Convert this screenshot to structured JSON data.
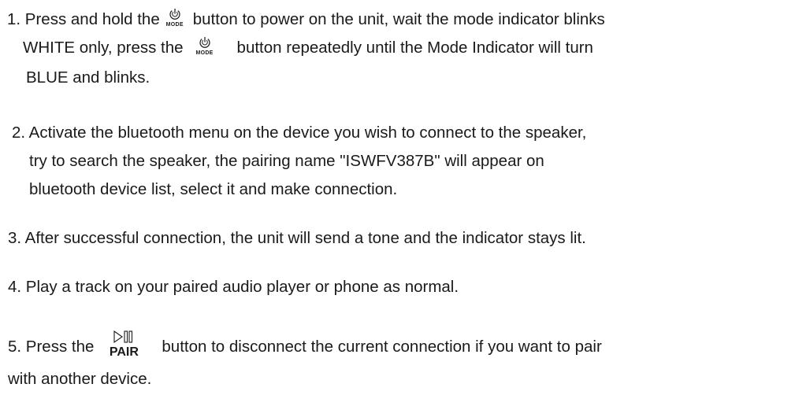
{
  "steps": [
    {
      "lines": [
        {
          "before": "1. Press and hold the",
          "after": "button to power on the unit, wait the mode indicator blinks"
        },
        {
          "before": "WHITE only,  press the",
          "after": "button repeatedly until the Mode Indicator will turn"
        },
        {
          "text": "BLUE and blinks."
        }
      ]
    },
    {
      "lines": [
        {
          "text": "2. Activate the bluetooth menu on the device you wish to connect to the speaker,"
        },
        {
          "text": "try to search the speaker,  the pairing name \"ISWFV387B\" will appear on"
        },
        {
          "text": "bluetooth device list, select it and make connection."
        }
      ]
    },
    {
      "lines": [
        {
          "text": "3. After successful connection, the unit will send a tone and the indicator stays lit."
        }
      ]
    },
    {
      "lines": [
        {
          "text": "4. Play a track on your paired audio player or phone as normal."
        }
      ]
    },
    {
      "lines": [
        {
          "before": "5. Press the",
          "after": "button to disconnect the current connection if you want to pair"
        },
        {
          "text": "with another device."
        }
      ]
    }
  ],
  "icons": {
    "mode": {
      "name": "power-mode-icon",
      "label": "MODE"
    },
    "pair": {
      "name": "play-pause-icon",
      "label": "PAIR"
    }
  }
}
